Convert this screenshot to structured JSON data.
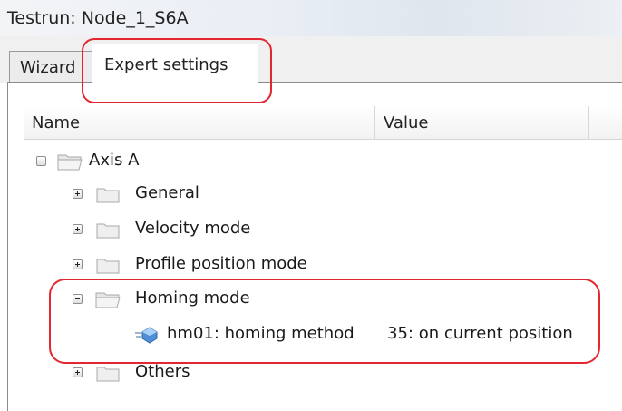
{
  "window": {
    "title": "Testrun: Node_1_S6A"
  },
  "tabs": [
    {
      "label": "Wizard",
      "selected": false
    },
    {
      "label": "Expert settings",
      "selected": true
    }
  ],
  "columns": {
    "name": "Name",
    "value": "Value"
  },
  "tree": {
    "root": {
      "label": "Axis A",
      "expanded": true
    },
    "items": [
      {
        "label": "General",
        "expanded": false
      },
      {
        "label": "Velocity mode",
        "expanded": false
      },
      {
        "label": "Profile position mode",
        "expanded": false
      },
      {
        "label": "Homing mode",
        "expanded": true
      },
      {
        "label": "Others",
        "expanded": false
      }
    ],
    "homing_param": {
      "name": "hm01: homing method",
      "value": "35: on current position"
    }
  },
  "colors": {
    "highlight": "#e3262f"
  }
}
